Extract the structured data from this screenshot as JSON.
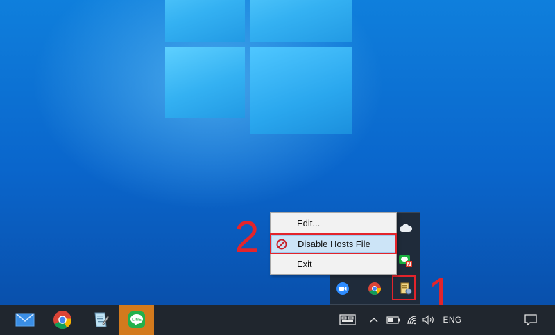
{
  "context_menu": {
    "items": [
      {
        "label": "Edit..."
      },
      {
        "label": "Disable Hosts File"
      },
      {
        "label": "Exit"
      }
    ]
  },
  "annotations": {
    "step1": "1",
    "step2": "2",
    "highlight_color": "#e3242b"
  },
  "taskbar": {
    "pinned_apps": [
      "mail-icon",
      "chrome-icon",
      "notepad-icon",
      "line-icon"
    ],
    "language": "ENG"
  },
  "tray_overflow": {
    "icons": [
      "onedrive-icon",
      "line-notify-icon",
      "zoom-icon",
      "chrome-icon",
      "hosts-file-editor-icon"
    ]
  },
  "colors": {
    "taskbar": "#20262e",
    "line_app_active": "#d37a1d",
    "menu_highlight": "#cce4f7",
    "desktop": "#0a66cc"
  }
}
